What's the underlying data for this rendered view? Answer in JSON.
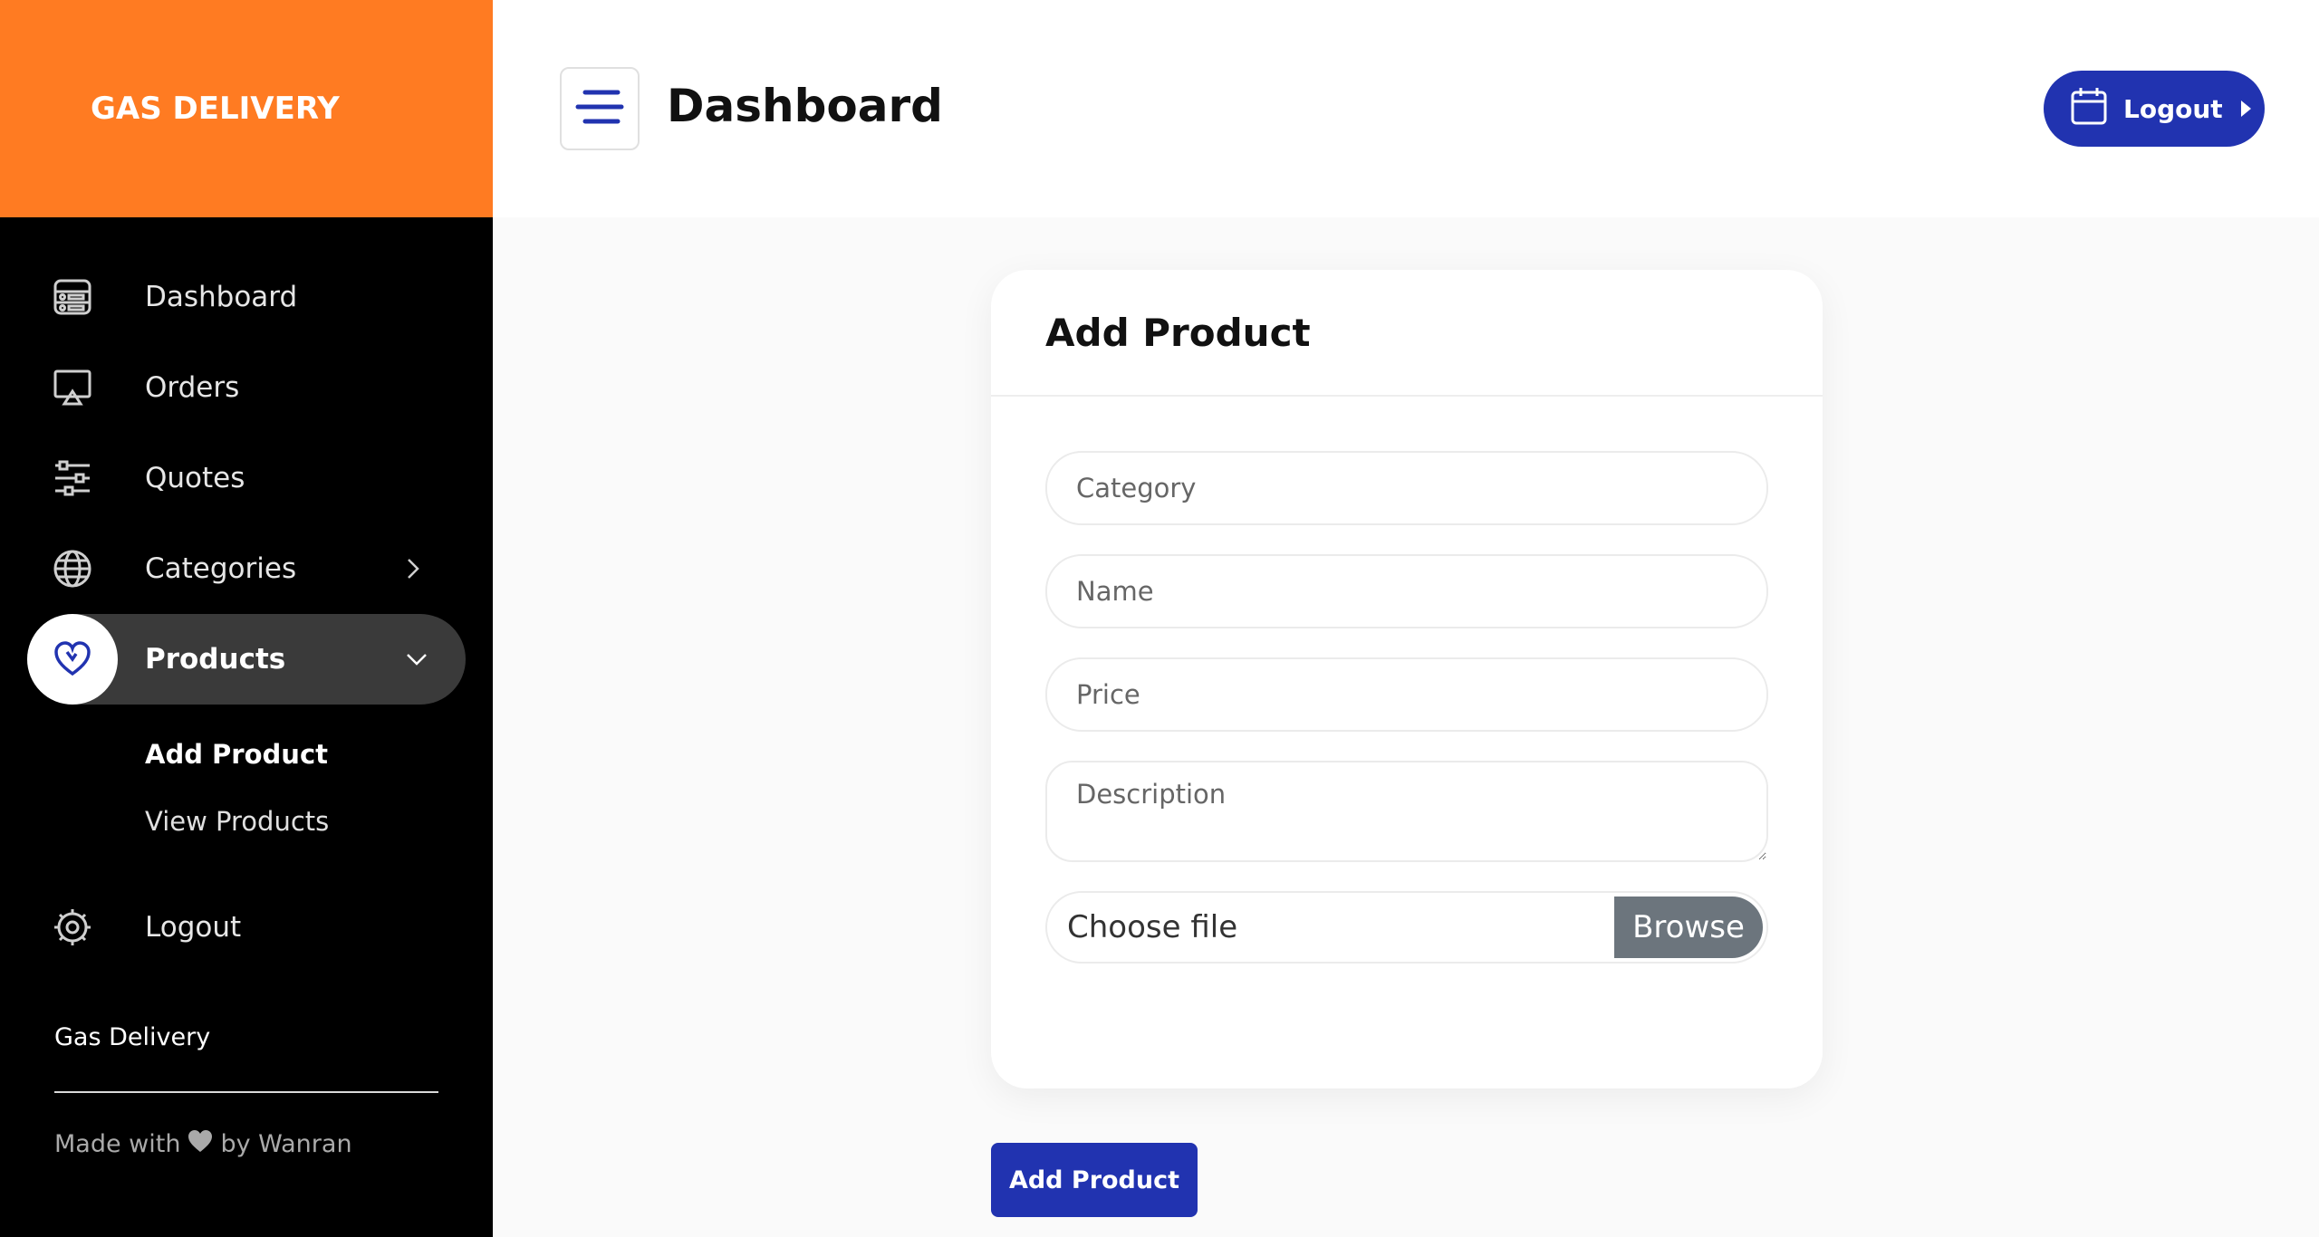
{
  "brand": {
    "title": "GAS DELIVERY",
    "color": "#ff7b22"
  },
  "header": {
    "title": "Dashboard",
    "logout_label": "Logout",
    "accent": "#2133b0"
  },
  "sidebar": {
    "items": [
      {
        "label": "Dashboard",
        "icon": "dashboard-icon"
      },
      {
        "label": "Orders",
        "icon": "monitor-icon"
      },
      {
        "label": "Quotes",
        "icon": "sliders-icon"
      },
      {
        "label": "Categories",
        "icon": "globe-icon",
        "chevron": "chevron-right-icon"
      },
      {
        "label": "Products",
        "icon": "heart-icon",
        "chevron": "chevron-down-icon",
        "active": true
      },
      {
        "label": "Logout",
        "icon": "gear-icon"
      }
    ],
    "subitems": [
      {
        "label": "Add Product",
        "current": true
      },
      {
        "label": "View Products"
      }
    ],
    "footer": {
      "name": "Gas Delivery",
      "made_prefix": "Made with",
      "made_suffix": "by Wanran"
    }
  },
  "form": {
    "title": "Add Product",
    "category_placeholder": "Category",
    "name_placeholder": "Name",
    "price_placeholder": "Price",
    "description_placeholder": "Description",
    "file_label": "Choose file",
    "browse_label": "Browse",
    "submit_label": "Add Product"
  }
}
